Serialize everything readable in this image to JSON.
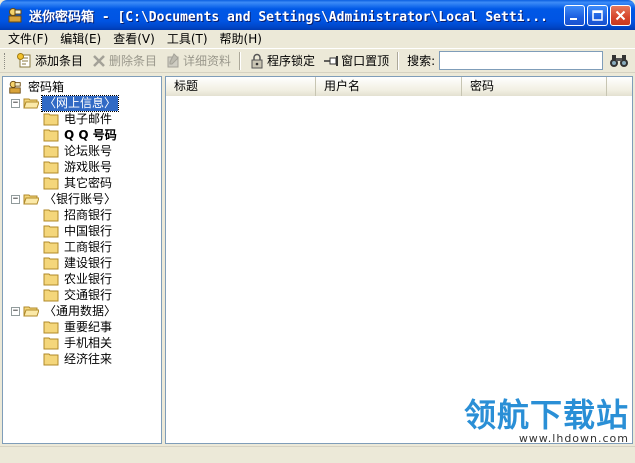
{
  "window": {
    "title": "迷你密码箱 - [C:\\Documents and Settings\\Administrator\\Local Setti...",
    "accent": "#0054e3"
  },
  "menu": [
    "文件(F)",
    "编辑(E)",
    "查看(V)",
    "工具(T)",
    "帮助(H)"
  ],
  "toolbar": {
    "add": "添加条目",
    "delete": "删除条目",
    "details": "详细资料",
    "lock": "程序锁定",
    "pin": "窗口置顶",
    "search_label": "搜索:",
    "search_value": ""
  },
  "tree": {
    "root": "密码箱",
    "groups": [
      {
        "label": "〈网上信息〉",
        "selected": true,
        "items": [
          "电子邮件",
          "Q Q 号码",
          "论坛账号",
          "游戏账号",
          "其它密码"
        ]
      },
      {
        "label": "〈银行账号〉",
        "selected": false,
        "items": [
          "招商银行",
          "中国银行",
          "工商银行",
          "建设银行",
          "农业银行",
          "交通银行"
        ]
      },
      {
        "label": "〈通用数据〉",
        "selected": false,
        "items": [
          "重要纪事",
          "手机相关",
          "经济往来"
        ]
      }
    ]
  },
  "list": {
    "columns": [
      "标题",
      "用户名",
      "密码"
    ]
  },
  "watermark": {
    "text": "领航下载站",
    "url": "www.lhdown.com"
  }
}
